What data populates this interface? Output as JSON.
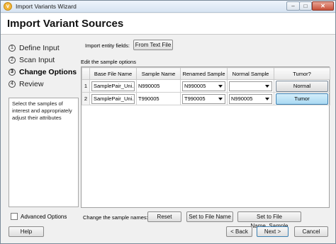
{
  "window": {
    "title": "Import Variants Wizard",
    "controls": {
      "minimize": "–",
      "maximize": "□",
      "close": "✕"
    }
  },
  "header": {
    "title": "Import Variant Sources"
  },
  "steps": [
    {
      "num": "1",
      "label": "Define Input"
    },
    {
      "num": "2",
      "label": "Scan Input"
    },
    {
      "num": "3",
      "label": "Change Options"
    },
    {
      "num": "4",
      "label": "Review"
    }
  ],
  "help_text": "Select the samples of interest and appropriately adjust their attributes",
  "advanced_options": {
    "label": "Advanced Options",
    "checked": false
  },
  "import_fields": {
    "label": "Import entity fields:",
    "button": "From Text File"
  },
  "edit_label": "Edit the sample options",
  "table": {
    "columns": [
      "",
      "Base File Name",
      "Sample Name",
      "Renamed Sample",
      "Normal Sample",
      "Tumor?"
    ],
    "rows": [
      {
        "index": "1",
        "base_file": "SamplePair_Uni...",
        "sample": "N990005",
        "renamed": "N990005",
        "normal": "",
        "tumor": "Normal"
      },
      {
        "index": "2",
        "base_file": "SamplePair_Uni...",
        "sample": "T990005",
        "renamed": "T990005",
        "normal": "N990005",
        "tumor": "Tumor"
      }
    ]
  },
  "change_names": {
    "label": "Change the sample names:",
    "reset": "Reset",
    "set_file": "Set to File Name",
    "set_file_sample": "Set to File Name_Sample"
  },
  "footer": {
    "help": "Help",
    "back": "< Back",
    "next": "Next >",
    "cancel": "Cancel"
  }
}
